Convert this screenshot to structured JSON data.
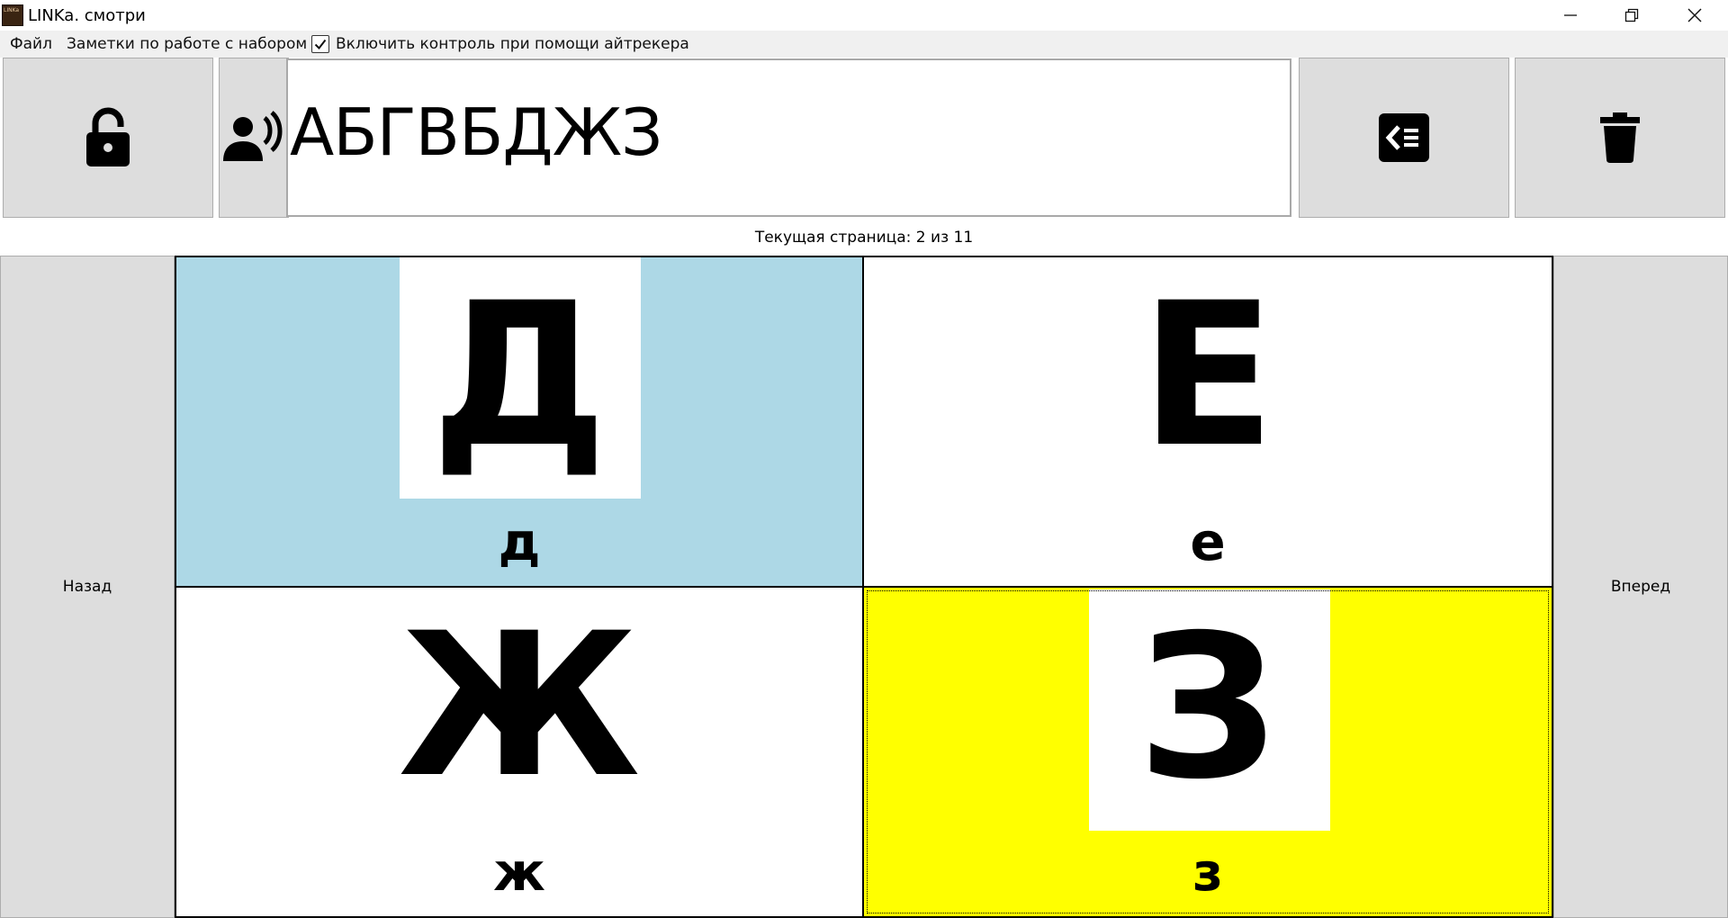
{
  "window": {
    "title": "LINKa. смотри",
    "icon_text": "LINKa"
  },
  "menu": {
    "file": "Файл",
    "notes": "Заметки по работе с набором",
    "eyetracker_label": "Включить контроль при помощи айтрекера",
    "eyetracker_checked": true
  },
  "toolbar": {
    "lock_icon": "unlock-icon",
    "speak_icon": "speak-icon",
    "backspace_icon": "backspace-icon",
    "clear_icon": "trash-icon"
  },
  "text_output": {
    "value": "АБГВБДЖЗ"
  },
  "status": {
    "page_text": "Текущая страница: 2 из 11"
  },
  "navigation": {
    "back": "Назад",
    "forward": "Вперед"
  },
  "cards": [
    {
      "glyph": "Д",
      "caption": "д",
      "background": "#add8e6",
      "state": "highlighted"
    },
    {
      "glyph": "Е",
      "caption": "е",
      "background": "#ffffff",
      "state": "normal"
    },
    {
      "glyph": "Ж",
      "caption": "ж",
      "background": "#ffffff",
      "state": "normal"
    },
    {
      "glyph": "З",
      "caption": "з",
      "background": "#ffff00",
      "state": "selected"
    }
  ]
}
